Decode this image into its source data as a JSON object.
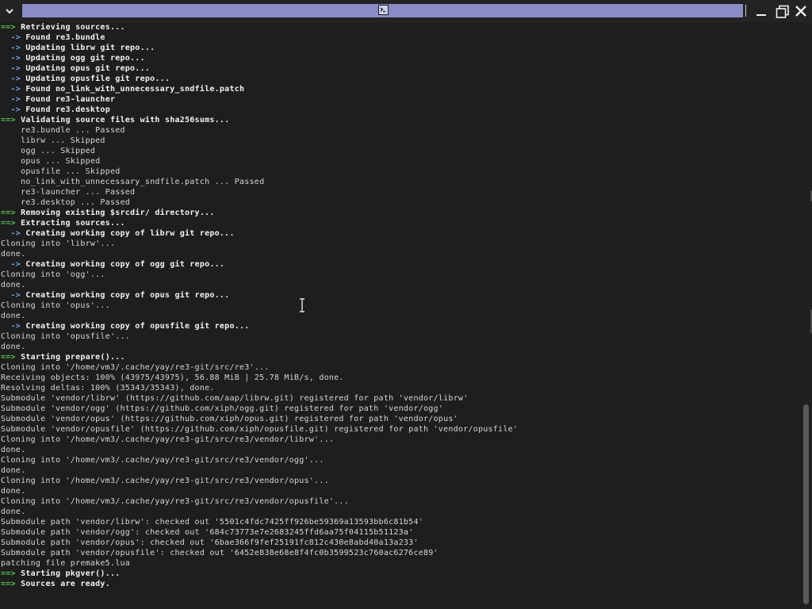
{
  "window": {
    "menu_glyph": "⌄"
  },
  "terminal": {
    "lines": [
      {
        "kind": "arrow",
        "text": "Retrieving sources..."
      },
      {
        "kind": "sub",
        "text": "Found re3.bundle"
      },
      {
        "kind": "sub",
        "text": "Updating librw git repo..."
      },
      {
        "kind": "sub",
        "text": "Updating ogg git repo..."
      },
      {
        "kind": "sub",
        "text": "Updating opus git repo..."
      },
      {
        "kind": "sub",
        "text": "Updating opusfile git repo..."
      },
      {
        "kind": "sub",
        "text": "Found no_link_with_unnecessary_sndfile.patch"
      },
      {
        "kind": "sub",
        "text": "Found re3-launcher"
      },
      {
        "kind": "sub",
        "text": "Found re3.desktop"
      },
      {
        "kind": "arrow",
        "text": "Validating source files with sha256sums..."
      },
      {
        "kind": "plain",
        "text": "    re3.bundle ... Passed"
      },
      {
        "kind": "plain",
        "text": "    librw ... Skipped"
      },
      {
        "kind": "plain",
        "text": "    ogg ... Skipped"
      },
      {
        "kind": "plain",
        "text": "    opus ... Skipped"
      },
      {
        "kind": "plain",
        "text": "    opusfile ... Skipped"
      },
      {
        "kind": "plain",
        "text": "    no_link_with_unnecessary_sndfile.patch ... Passed"
      },
      {
        "kind": "plain",
        "text": "    re3-launcher ... Passed"
      },
      {
        "kind": "plain",
        "text": "    re3.desktop ... Passed"
      },
      {
        "kind": "arrow",
        "text": "Removing existing $srcdir/ directory..."
      },
      {
        "kind": "arrow",
        "text": "Extracting sources..."
      },
      {
        "kind": "sub",
        "text": "Creating working copy of librw git repo..."
      },
      {
        "kind": "plain",
        "text": "Cloning into 'librw'..."
      },
      {
        "kind": "plain",
        "text": "done."
      },
      {
        "kind": "sub",
        "text": "Creating working copy of ogg git repo..."
      },
      {
        "kind": "plain",
        "text": "Cloning into 'ogg'..."
      },
      {
        "kind": "plain",
        "text": "done."
      },
      {
        "kind": "sub",
        "text": "Creating working copy of opus git repo..."
      },
      {
        "kind": "plain",
        "text": "Cloning into 'opus'..."
      },
      {
        "kind": "plain",
        "text": "done."
      },
      {
        "kind": "sub",
        "text": "Creating working copy of opusfile git repo..."
      },
      {
        "kind": "plain",
        "text": "Cloning into 'opusfile'..."
      },
      {
        "kind": "plain",
        "text": "done."
      },
      {
        "kind": "arrow",
        "text": "Starting prepare()..."
      },
      {
        "kind": "plain",
        "text": "Cloning into '/home/vm3/.cache/yay/re3-git/src/re3'..."
      },
      {
        "kind": "plain",
        "text": "Receiving objects: 100% (43975/43975), 56.88 MiB | 25.78 MiB/s, done."
      },
      {
        "kind": "plain",
        "text": "Resolving deltas: 100% (35343/35343), done."
      },
      {
        "kind": "plain",
        "text": "Submodule 'vendor/librw' (https://github.com/aap/librw.git) registered for path 'vendor/librw'"
      },
      {
        "kind": "plain",
        "text": "Submodule 'vendor/ogg' (https://github.com/xiph/ogg.git) registered for path 'vendor/ogg'"
      },
      {
        "kind": "plain",
        "text": "Submodule 'vendor/opus' (https://github.com/xiph/opus.git) registered for path 'vendor/opus'"
      },
      {
        "kind": "plain",
        "text": "Submodule 'vendor/opusfile' (https://github.com/xiph/opusfile.git) registered for path 'vendor/opusfile'"
      },
      {
        "kind": "plain",
        "text": "Cloning into '/home/vm3/.cache/yay/re3-git/src/re3/vendor/librw'..."
      },
      {
        "kind": "plain",
        "text": "done."
      },
      {
        "kind": "plain",
        "text": "Cloning into '/home/vm3/.cache/yay/re3-git/src/re3/vendor/ogg'..."
      },
      {
        "kind": "plain",
        "text": "done."
      },
      {
        "kind": "plain",
        "text": "Cloning into '/home/vm3/.cache/yay/re3-git/src/re3/vendor/opus'..."
      },
      {
        "kind": "plain",
        "text": "done."
      },
      {
        "kind": "plain",
        "text": "Cloning into '/home/vm3/.cache/yay/re3-git/src/re3/vendor/opusfile'..."
      },
      {
        "kind": "plain",
        "text": "done."
      },
      {
        "kind": "plain",
        "text": "Submodule path 'vendor/librw': checked out '5501c4fdc7425ff926be59369a13593bb6c81b54'"
      },
      {
        "kind": "plain",
        "text": "Submodule path 'vendor/ogg': checked out '684c73773e7e2683245ffd6aa75f04115b51123a'"
      },
      {
        "kind": "plain",
        "text": "Submodule path 'vendor/opus': checked out '6bae366f9fef25191fc812c430e8abd40a13a233'"
      },
      {
        "kind": "plain",
        "text": "Submodule path 'vendor/opusfile': checked out '6452e838e68e8f4fc0b3599523c760ac6276ce89'"
      },
      {
        "kind": "plain",
        "text": "patching file premake5.lua"
      },
      {
        "kind": "arrow",
        "text": "Starting pkgver()..."
      },
      {
        "kind": "arrow",
        "text": "Sources are ready."
      }
    ],
    "arrow_prefix": "==> ",
    "sub_prefix": "  -> "
  },
  "colors": {
    "background": "#1e1e1e",
    "title_field": "#8a8cc6",
    "arrow": "#4ec24e",
    "sub_arrow": "#6fa4e8",
    "text": "#d4d4d4"
  },
  "scrollbar": {
    "position_fraction": 1.0
  }
}
